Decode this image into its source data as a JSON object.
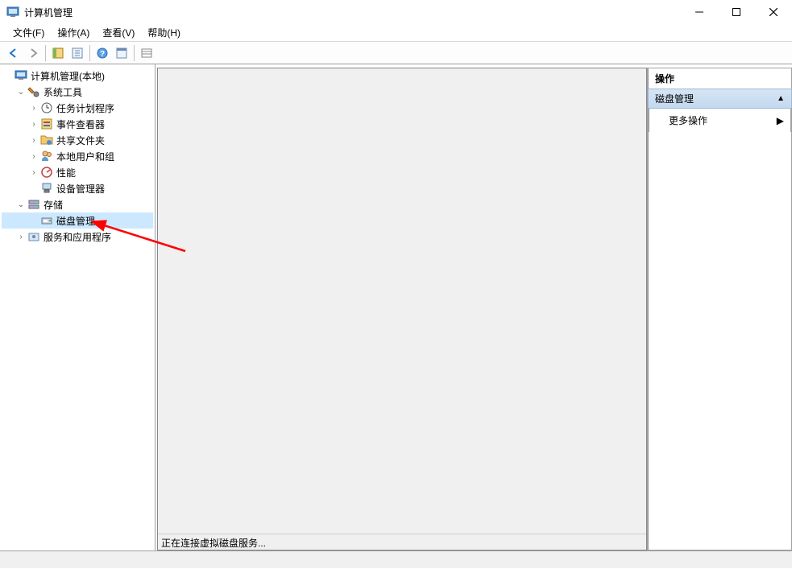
{
  "window": {
    "title": "计算机管理"
  },
  "menu": {
    "file": "文件(F)",
    "action": "操作(A)",
    "view": "查看(V)",
    "help": "帮助(H)"
  },
  "tree": {
    "root": "计算机管理(本地)",
    "system_tools": "系统工具",
    "task_scheduler": "任务计划程序",
    "event_viewer": "事件查看器",
    "shared_folders": "共享文件夹",
    "local_users": "本地用户和组",
    "performance": "性能",
    "device_manager": "设备管理器",
    "storage": "存储",
    "disk_management": "磁盘管理",
    "services_apps": "服务和应用程序"
  },
  "content": {
    "status": "正在连接虚拟磁盘服务..."
  },
  "actions": {
    "header": "操作",
    "section": "磁盘管理",
    "more": "更多操作"
  }
}
